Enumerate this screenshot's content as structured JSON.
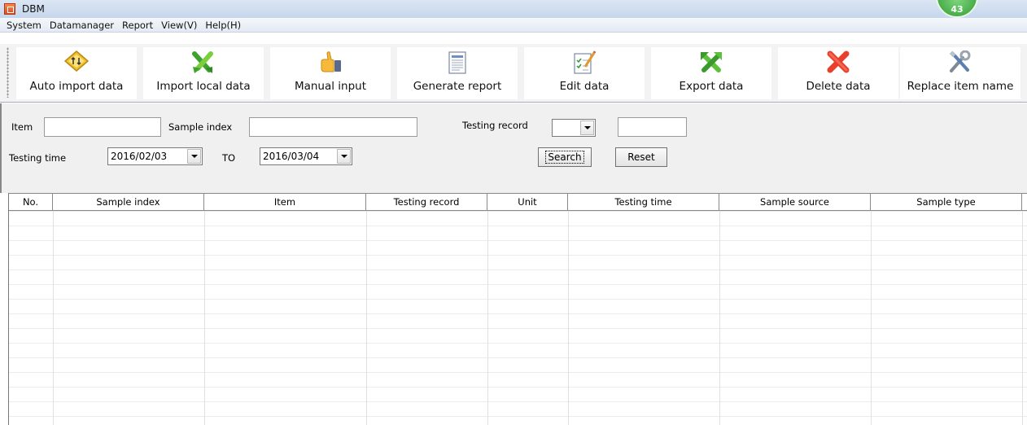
{
  "window": {
    "title": "DBM",
    "badge": "43"
  },
  "menu": [
    "System",
    "Datamanager",
    "Report",
    "View(V)",
    "Help(H)"
  ],
  "toolbar": [
    {
      "label": "Auto import data",
      "icon": "auto-import-icon"
    },
    {
      "label": "Import local data",
      "icon": "import-arrows-icon"
    },
    {
      "label": "Manual input",
      "icon": "thumbs-up-icon"
    },
    {
      "label": "Generate report",
      "icon": "report-document-icon"
    },
    {
      "label": "Edit data",
      "icon": "edit-checklist-icon"
    },
    {
      "label": "Export data",
      "icon": "export-arrows-icon"
    },
    {
      "label": "Delete data",
      "icon": "delete-x-icon"
    },
    {
      "label": "Replace item name",
      "icon": "tools-icon"
    }
  ],
  "filter": {
    "item_label": "Item",
    "item_value": "",
    "sample_index_label": "Sample index",
    "sample_index_value": "",
    "testing_record_label": "Testing record",
    "testing_record_select": "",
    "testing_record_value": "",
    "testing_time_label": "Testing time",
    "date_from": "2016/02/03",
    "to_label": "TO",
    "date_to": "2016/03/04",
    "search_label": "Search",
    "reset_label": "Reset"
  },
  "table": {
    "columns": [
      "No.",
      "Sample index",
      "Item",
      "Testing record",
      "Unit",
      "Testing time",
      "Sample source",
      "Sample type"
    ],
    "rows": []
  },
  "colors": {
    "titlebar": "#c6d6ec",
    "badge": "#2f9a2f",
    "toolbar_bg": "#f3f3f3",
    "filter_bg": "#f0f0f0"
  }
}
